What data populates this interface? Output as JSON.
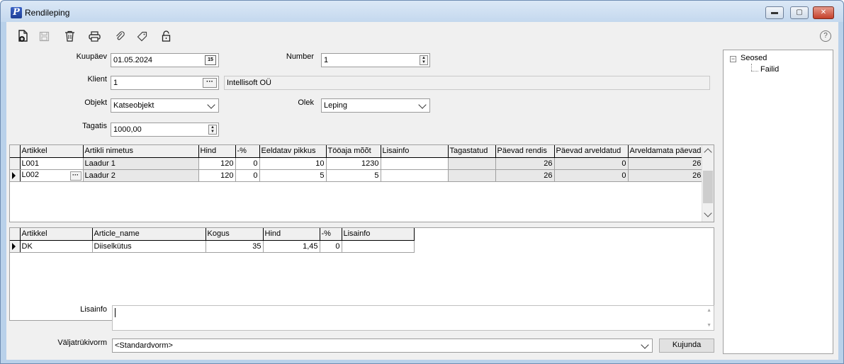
{
  "window": {
    "title": "Rendileping",
    "app_icon_letter": "P",
    "minimize_glyph": "▬",
    "maximize_glyph": "▢",
    "close_glyph": "✕",
    "help_glyph": "?"
  },
  "toolbar": {
    "icons": [
      "new-document-icon",
      "save-icon",
      "delete-icon",
      "print-icon",
      "attach-icon",
      "tag-icon",
      "unlock-icon"
    ]
  },
  "form": {
    "kuupaev": {
      "label": "Kuupäev",
      "value": "01.05.2024",
      "calendar_glyph": "15"
    },
    "number": {
      "label": "Number",
      "value": "1"
    },
    "klient": {
      "label": "Klient",
      "value": "1",
      "name": "Intellisoft OÜ",
      "ellipsis": "···"
    },
    "objekt": {
      "label": "Objekt",
      "value": "Katseobjekt"
    },
    "olek": {
      "label": "Olek",
      "value": "Leping"
    },
    "tagatis": {
      "label": "Tagatis",
      "value": "1000,00"
    }
  },
  "grid1": {
    "columns": [
      "Artikkel",
      "Artikli nimetus",
      "Hind",
      "-%",
      "Eeldatav pikkus",
      "Tööaja mõõt",
      "Lisainfo",
      "Tagastatud",
      "Päevad rendis",
      "Päevad arveldatud",
      "Arveldamata päevad"
    ],
    "rows": [
      [
        "L001",
        "Laadur 1",
        "120",
        "0",
        "10",
        "1230",
        "",
        "",
        "26",
        "0",
        "26"
      ],
      [
        "L002",
        "Laadur 2",
        "120",
        "0",
        "5",
        "5",
        "",
        "",
        "26",
        "0",
        "26"
      ]
    ],
    "ellipsis": "···"
  },
  "grid2": {
    "columns": [
      "Artikkel",
      "Article_name",
      "Kogus",
      "Hind",
      "-%",
      "Lisainfo"
    ],
    "rows": [
      [
        "DK",
        "Diiselkütus",
        "35",
        "1,45",
        "0",
        ""
      ]
    ]
  },
  "lisainfo": {
    "label": "Lisainfo",
    "value": ""
  },
  "valjatrukivorm": {
    "label": "Väljatrükivorm",
    "value": "<Standardvorm>"
  },
  "kujunda_button": "Kujunda",
  "tree": {
    "root": "Seosed",
    "expander": "−",
    "child": "Failid"
  }
}
